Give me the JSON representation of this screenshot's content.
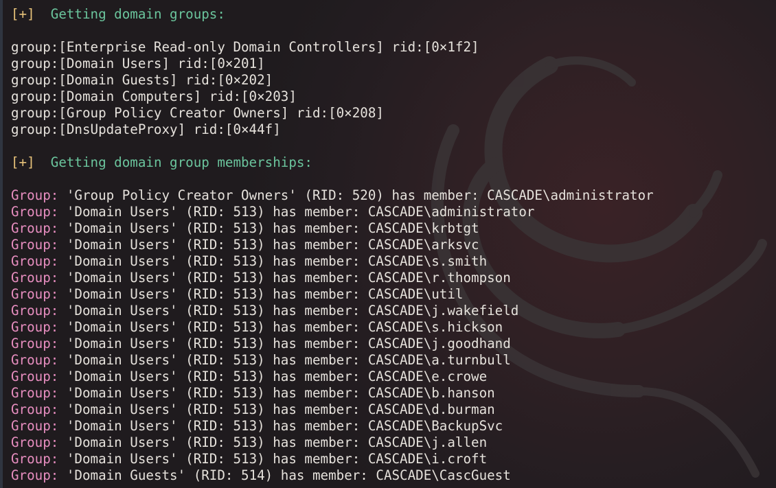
{
  "sections": [
    {
      "tag": "[+]",
      "title": "Getting domain groups:",
      "lines": [
        "group:[Enterprise Read-only Domain Controllers] rid:[0×1f2]",
        "group:[Domain Users] rid:[0×201]",
        "group:[Domain Guests] rid:[0×202]",
        "group:[Domain Computers] rid:[0×203]",
        "group:[Group Policy Creator Owners] rid:[0×208]",
        "group:[DnsUpdateProxy] rid:[0×44f]"
      ]
    },
    {
      "tag": "[+]",
      "title": "Getting domain group memberships:",
      "label": "Group:",
      "members": [
        "'Group Policy Creator Owners' (RID: 520) has member: CASCADE\\administrator",
        "'Domain Users' (RID: 513) has member: CASCADE\\administrator",
        "'Domain Users' (RID: 513) has member: CASCADE\\krbtgt",
        "'Domain Users' (RID: 513) has member: CASCADE\\arksvc",
        "'Domain Users' (RID: 513) has member: CASCADE\\s.smith",
        "'Domain Users' (RID: 513) has member: CASCADE\\r.thompson",
        "'Domain Users' (RID: 513) has member: CASCADE\\util",
        "'Domain Users' (RID: 513) has member: CASCADE\\j.wakefield",
        "'Domain Users' (RID: 513) has member: CASCADE\\s.hickson",
        "'Domain Users' (RID: 513) has member: CASCADE\\j.goodhand",
        "'Domain Users' (RID: 513) has member: CASCADE\\a.turnbull",
        "'Domain Users' (RID: 513) has member: CASCADE\\e.crowe",
        "'Domain Users' (RID: 513) has member: CASCADE\\b.hanson",
        "'Domain Users' (RID: 513) has member: CASCADE\\d.burman",
        "'Domain Users' (RID: 513) has member: CASCADE\\BackupSvc",
        "'Domain Users' (RID: 513) has member: CASCADE\\j.allen",
        "'Domain Users' (RID: 513) has member: CASCADE\\i.croft",
        "'Domain Guests' (RID: 514) has member: CASCADE\\CascGuest"
      ]
    }
  ],
  "colors": {
    "tag": "#e8c37a",
    "header": "#6bc59d",
    "group_label": "#e88ec0",
    "text": "#e6e2dc",
    "background": "#1f1b1e"
  },
  "background_icon": "dragon-logo-watermark"
}
